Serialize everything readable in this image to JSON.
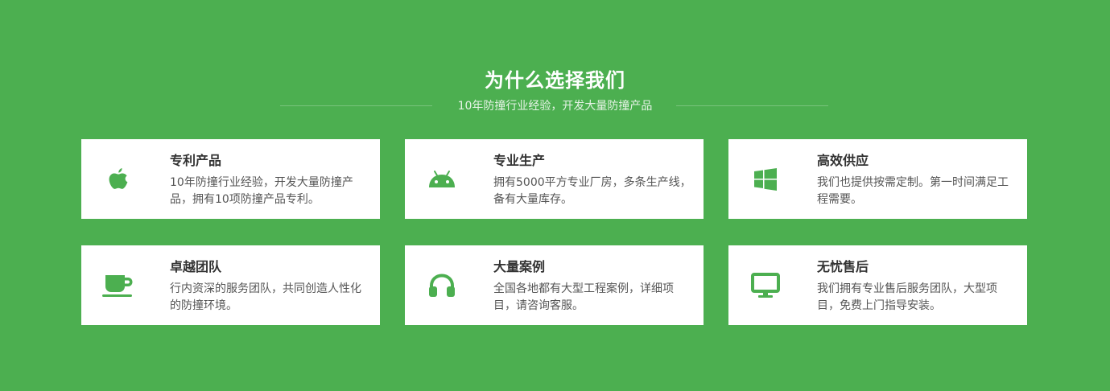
{
  "header": {
    "title": "为什么选择我们",
    "subtitle": "10年防撞行业经验，开发大量防撞产品"
  },
  "features": [
    {
      "icon": "apple-icon",
      "title": "专利产品",
      "desc": "10年防撞行业经验，开发大量防撞产品，拥有10项防撞产品专利。"
    },
    {
      "icon": "android-icon",
      "title": "专业生产",
      "desc": "拥有5000平方专业厂房，多条生产线，备有大量库存。"
    },
    {
      "icon": "windows-icon",
      "title": "高效供应",
      "desc": "我们也提供按需定制。第一时间满足工程需要。"
    },
    {
      "icon": "coffee-cup-icon",
      "title": "卓越团队",
      "desc": "行内资深的服务团队，共同创造人性化的防撞环境。"
    },
    {
      "icon": "headphones-icon",
      "title": "大量案例",
      "desc": "全国各地都有大型工程案例，详细项目，请咨询客服。"
    },
    {
      "icon": "desktop-monitor-icon",
      "title": "无忧售后",
      "desc": "我们拥有专业售后服务团队，大型项目，免费上门指导安装。"
    }
  ],
  "colors": {
    "background": "#4caf50",
    "icon": "#4caf50",
    "card": "#ffffff",
    "title_text": "#333333",
    "desc_text": "#555555"
  }
}
